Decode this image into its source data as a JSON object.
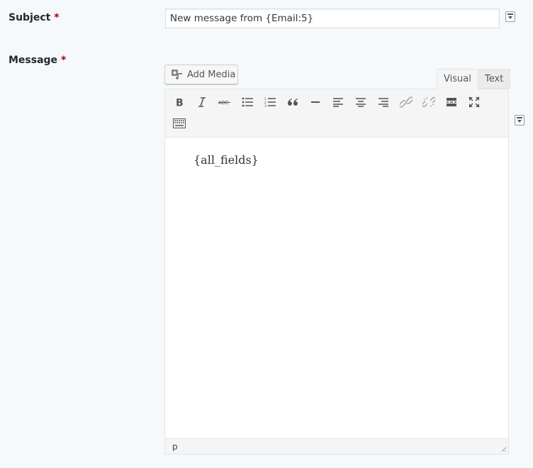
{
  "subject": {
    "label": "Subject",
    "required_mark": "*",
    "value": "New message from {Email:5}"
  },
  "message": {
    "label": "Message",
    "required_mark": "*"
  },
  "editor": {
    "add_media_label": "Add Media",
    "tabs": [
      {
        "label": "Visual",
        "active": true
      },
      {
        "label": "Text",
        "active": false
      }
    ],
    "toolbar_icons": [
      "bold-icon",
      "italic-icon",
      "strikethrough-icon",
      "bulleted-list-icon",
      "numbered-list-icon",
      "blockquote-icon",
      "horizontal-line-icon",
      "align-left-icon",
      "align-center-icon",
      "align-right-icon",
      "insert-link-icon",
      "remove-link-icon",
      "read-more-icon",
      "fullscreen-icon",
      "toolbar-toggle-icon"
    ],
    "content": "{all_fields}",
    "path": "p"
  },
  "colors": {
    "page_background": "#f5f9fc",
    "required": "#aa0000",
    "toolbar_background": "#f5f5f5"
  }
}
